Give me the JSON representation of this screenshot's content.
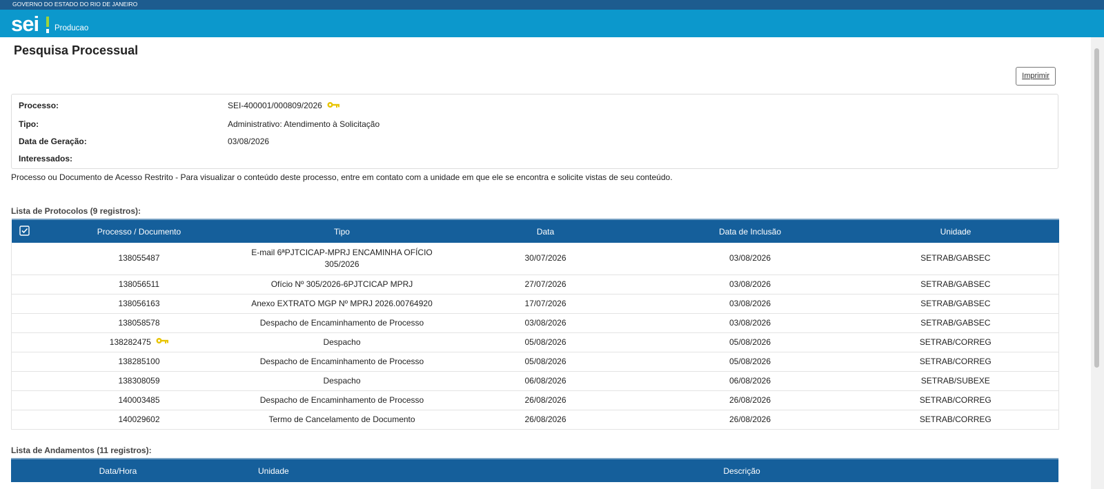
{
  "header": {
    "government": "GOVERNO DO ESTADO DO RIO DE JANEIRO",
    "logo": "sei!",
    "environment": "Producao",
    "colors": {
      "top_bar": "#1d5c8f",
      "app_bar": "#0c98cc",
      "table_header": "#155f9b"
    }
  },
  "page": {
    "title": "Pesquisa Processual",
    "print_button": "Imprimir"
  },
  "process_info": {
    "labels": {
      "processo": "Processo:",
      "tipo": "Tipo:",
      "data_geracao": "Data de Geração:",
      "interessados": "Interessados:"
    },
    "values": {
      "processo": "SEI-400001/000809/2026",
      "tipo": "Administrativo: Atendimento à Solicitação",
      "data_geracao": "03/08/2026",
      "interessados": ""
    },
    "restricted_message": "Processo ou Documento de Acesso Restrito - Para visualizar o conteúdo deste processo, entre em contato com a unidade em que ele se encontra e solicite vistas de seu conteúdo."
  },
  "protocols": {
    "title": "Lista de Protocolos (9 registros):",
    "columns": [
      "Processo / Documento",
      "Tipo",
      "Data",
      "Data de Inclusão",
      "Unidade"
    ],
    "header_icon": "checkbox-icon",
    "rows": [
      {
        "doc": "138055487",
        "tipo_line1": "E-mail 6ªPJTCICAP-MPRJ ENCAMINHA OFÍCIO",
        "tipo_line2": "305/2026",
        "data": "30/07/2026",
        "inclusao": "03/08/2026",
        "unidade": "SETRAB/GABSEC"
      },
      {
        "doc": "138056511",
        "tipo": "Ofício Nº 305/2026-6PJTCICAP MPRJ",
        "data": "27/07/2026",
        "inclusao": "03/08/2026",
        "unidade": "SETRAB/GABSEC"
      },
      {
        "doc": "138056163",
        "tipo": "Anexo EXTRATO MGP Nº MPRJ 2026.00764920",
        "data": "17/07/2026",
        "inclusao": "03/08/2026",
        "unidade": "SETRAB/GABSEC"
      },
      {
        "doc": "138058578",
        "tipo": "Despacho de Encaminhamento de Processo",
        "data": "03/08/2026",
        "inclusao": "03/08/2026",
        "unidade": "SETRAB/GABSEC"
      },
      {
        "doc": "138282475",
        "tipo": "Despacho",
        "data": "05/08/2026",
        "inclusao": "05/08/2026",
        "unidade": "SETRAB/CORREG",
        "restricted": true
      },
      {
        "doc": "138285100",
        "tipo": "Despacho de Encaminhamento de Processo",
        "data": "05/08/2026",
        "inclusao": "05/08/2026",
        "unidade": "SETRAB/CORREG"
      },
      {
        "doc": "138308059",
        "tipo": "Despacho",
        "data": "06/08/2026",
        "inclusao": "06/08/2026",
        "unidade": "SETRAB/SUBEXE"
      },
      {
        "doc": "140003485",
        "tipo": "Despacho de Encaminhamento de Processo",
        "data": "26/08/2026",
        "inclusao": "26/08/2026",
        "unidade": "SETRAB/CORREG"
      },
      {
        "doc": "140029602",
        "tipo": "Termo de Cancelamento de Documento",
        "data": "26/08/2026",
        "inclusao": "26/08/2026",
        "unidade": "SETRAB/CORREG"
      }
    ]
  },
  "andamentos": {
    "title": "Lista de Andamentos (11 registros):",
    "columns": [
      "Data/Hora",
      "Unidade",
      "Descrição"
    ]
  }
}
